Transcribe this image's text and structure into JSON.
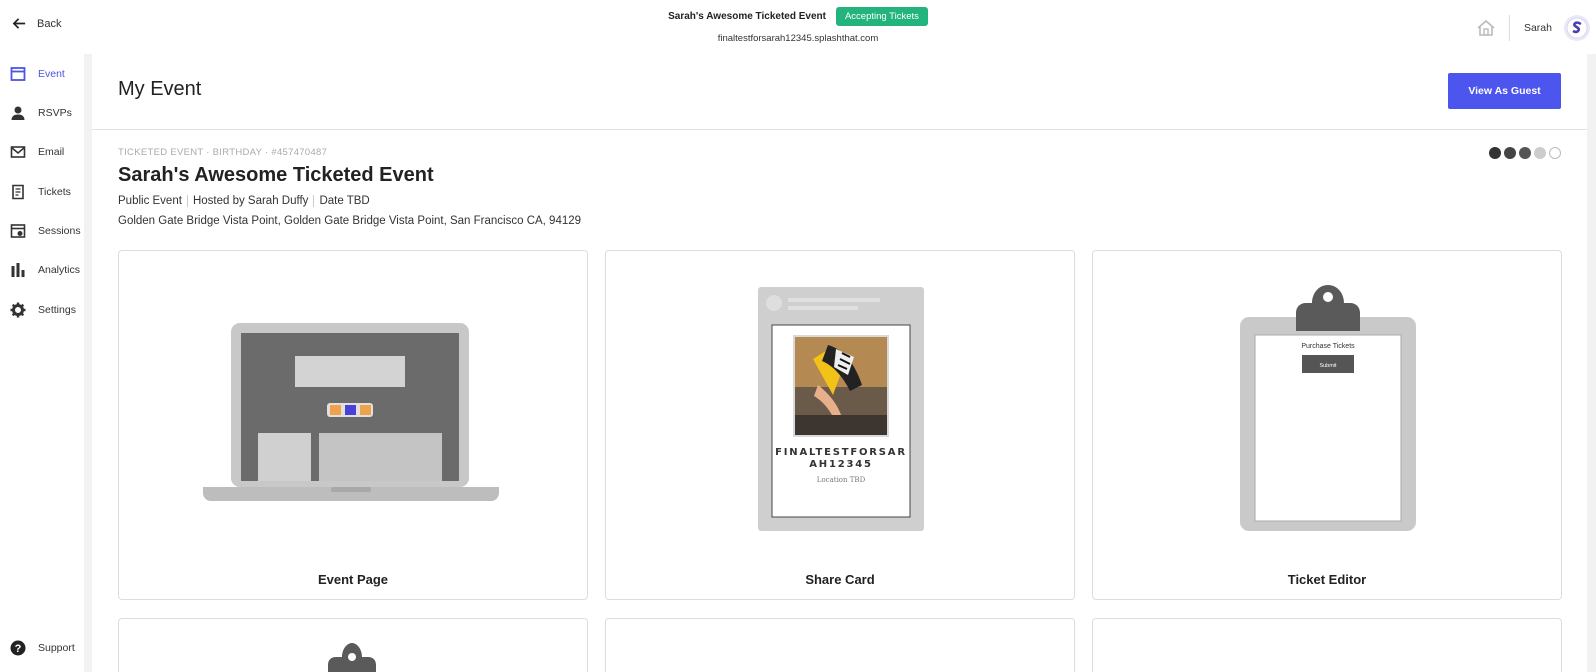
{
  "topbar": {
    "back_label": "Back",
    "event_name": "Sarah's Awesome Ticketed Event",
    "status": "Accepting Tickets",
    "url": "finaltestforsarah12345.splashthat.com",
    "user_name": "Sarah",
    "avatar_letter": "S"
  },
  "sidebar": {
    "items": [
      {
        "label": "Event",
        "icon": "calendar-icon",
        "active": true
      },
      {
        "label": "RSVPs",
        "icon": "person-icon"
      },
      {
        "label": "Email",
        "icon": "envelope-icon"
      },
      {
        "label": "Tickets",
        "icon": "ticket-icon"
      },
      {
        "label": "Sessions",
        "icon": "sessions-icon"
      },
      {
        "label": "Analytics",
        "icon": "bar-chart-icon"
      },
      {
        "label": "Settings",
        "icon": "gear-icon"
      }
    ],
    "support_label": "Support"
  },
  "main": {
    "page_title": "My Event",
    "view_as_guest": "View As Guest",
    "meta": "TICKETED EVENT · BIRTHDAY · #457470487",
    "event_title": "Sarah's Awesome Ticketed Event",
    "visibility": "Public Event",
    "hosted_by": "Hosted by Sarah Duffy",
    "date": "Date TBD",
    "address": "Golden Gate Bridge Vista Point, Golden Gate Bridge Vista Point, San Francisco CA, 94129",
    "progress": {
      "completed_steps": 3,
      "total_steps": 5
    },
    "cards": [
      {
        "label": "Event Page"
      },
      {
        "label": "Share Card",
        "card_title": "FINALTESTFORSAR AH12345",
        "card_location": "Location TBD"
      },
      {
        "label": "Ticket Editor",
        "form_title": "Purchase Tickets",
        "form_button": "Submit"
      }
    ]
  },
  "colors": {
    "accent": "#4c55ee",
    "status_green": "#23b47e"
  }
}
